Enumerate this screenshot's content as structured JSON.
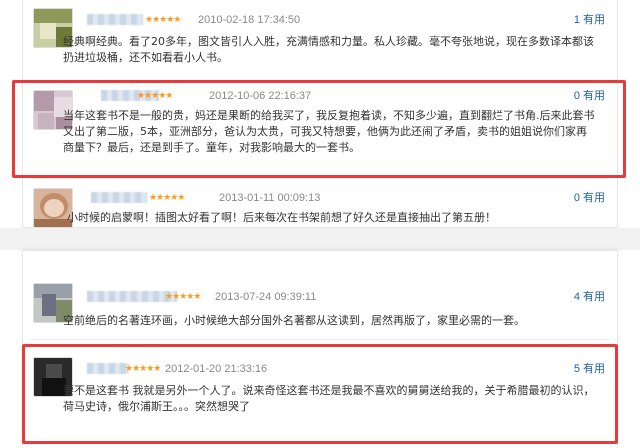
{
  "reviews": [
    {
      "stars": "★★★★★",
      "date": "2010-02-18 17:34:50",
      "useful": "1 有用",
      "text": "经典啊经典。看了20多年，图文皆引人入胜，充满情感和力量。私人珍藏。毫不夸张地说，现在多数译本都该扔进垃圾桶，还不如看看小人书。"
    },
    {
      "stars": "★★★★★",
      "date": "2012-10-06 22:16:37",
      "useful": "0 有用",
      "text": "当年这套书不是一般的贵，妈还是果断的给我买了，我反复抱着读，不知多少遍，直到翻烂了书角.后来此套书又出了第二版，5本，亚洲部分，爸认为太贵，可我又特想要，他俩为此还闹了矛盾，卖书的姐姐说你们家再商量下？最后，还是到手了。童年，对我影响最大的一套书。"
    },
    {
      "stars": "★★★★★",
      "date": "2013-01-11 00:09:13",
      "useful": "0 有用",
      "text": "小时候的启蒙啊！插图太好看了啊！后来每次在书架前想了好久还是直接抽出了第五册！"
    },
    {
      "stars": "★★★★★",
      "date": "2013-07-24 09:39:11",
      "useful": "4 有用",
      "text": "空前绝后的名著连环画，小时候绝大部分国外名著都从这读到，居然再版了，家里必需的一套。"
    },
    {
      "stars": "★★★★★",
      "date": "2012-01-20 21:33:16",
      "useful": "5 有用",
      "text": "要不是这套书 我就是另外一个人了。说来奇怪这套书还是我最不喜欢的舅舅送给我的，关于希腊最初的认识，荷马史诗，俄尔浦斯王。。。突然想哭了"
    }
  ],
  "colors": {
    "highlight": "#e53b3b",
    "stars": "#ff9b1a",
    "useful": "#1f5fa8",
    "date": "#8a8a8a"
  },
  "icons": {
    "star": "star-icon"
  }
}
